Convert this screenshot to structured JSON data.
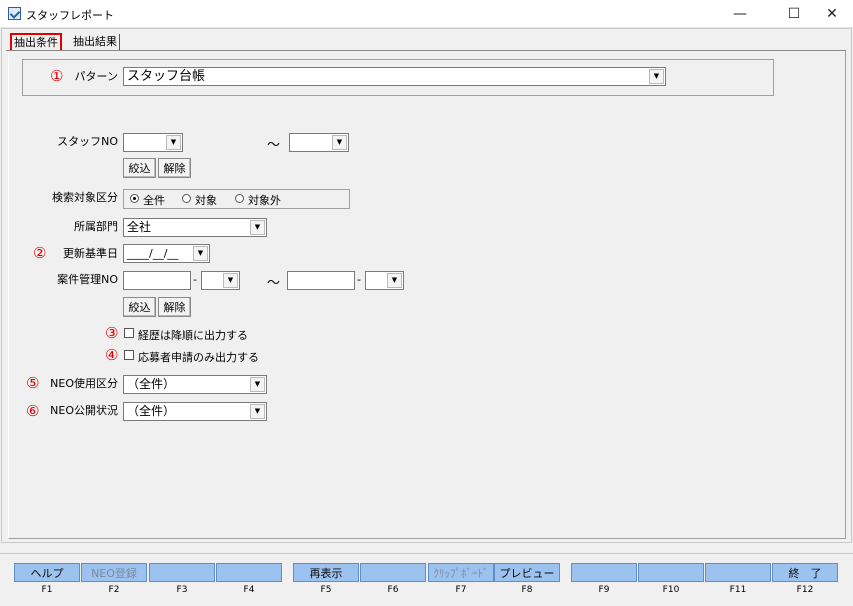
{
  "window": {
    "title": "スタッフレポート",
    "minimize": "—",
    "maximize": "☐",
    "close": "✕"
  },
  "tabs": [
    {
      "label": "抽出条件"
    },
    {
      "label": "抽出結果"
    }
  ],
  "markers": {
    "m1": "①",
    "m2": "②",
    "m3": "③",
    "m4": "④",
    "m5": "⑤",
    "m6": "⑥"
  },
  "pattern": {
    "label": "パターン",
    "value": "スタッフ台帳"
  },
  "staff_no": {
    "label": "スタッフNO",
    "from": "",
    "to": "",
    "tilde": "～",
    "filter_btn": "絞込",
    "clear_btn": "解除"
  },
  "search_target": {
    "label": "検索対象区分",
    "options": [
      "全件",
      "対象",
      "対象外"
    ],
    "selected": "全件"
  },
  "department": {
    "label": "所属部門",
    "value": "全社"
  },
  "update_date": {
    "label": "更新基準日",
    "value": "____/__/__"
  },
  "case_no": {
    "label": "案件管理NO",
    "tilde": "～",
    "dash": "-",
    "filter_btn": "絞込",
    "clear_btn": "解除"
  },
  "checkboxes": {
    "history_desc": "経歴は降順に出力する",
    "applicants_only": "応募者申請のみ出力する"
  },
  "neo_use": {
    "label": "NEO使用区分",
    "value": "（全件）"
  },
  "neo_public": {
    "label": "NEO公開状況",
    "value": "（全件）"
  },
  "fkeys": [
    {
      "key": "F1",
      "label": "ヘルプ",
      "enabled": true
    },
    {
      "key": "F2",
      "label": "NEO登録",
      "enabled": false
    },
    {
      "key": "F3",
      "label": "",
      "enabled": true
    },
    {
      "key": "F4",
      "label": "",
      "enabled": true
    },
    {
      "key": "F5",
      "label": "再表示",
      "enabled": true
    },
    {
      "key": "F6",
      "label": "",
      "enabled": true
    },
    {
      "key": "F7",
      "label": "ｸﾘｯﾌﾟﾎﾞｰﾄﾞ",
      "enabled": false
    },
    {
      "key": "F8",
      "label": "プレビュー",
      "enabled": true
    },
    {
      "key": "F9",
      "label": "",
      "enabled": true
    },
    {
      "key": "F10",
      "label": "",
      "enabled": true
    },
    {
      "key": "F11",
      "label": "",
      "enabled": true
    },
    {
      "key": "F12",
      "label": "終　了",
      "enabled": true
    }
  ],
  "colors": {
    "fkey_bg": "#9cc3ef",
    "marker": "#e00000"
  }
}
